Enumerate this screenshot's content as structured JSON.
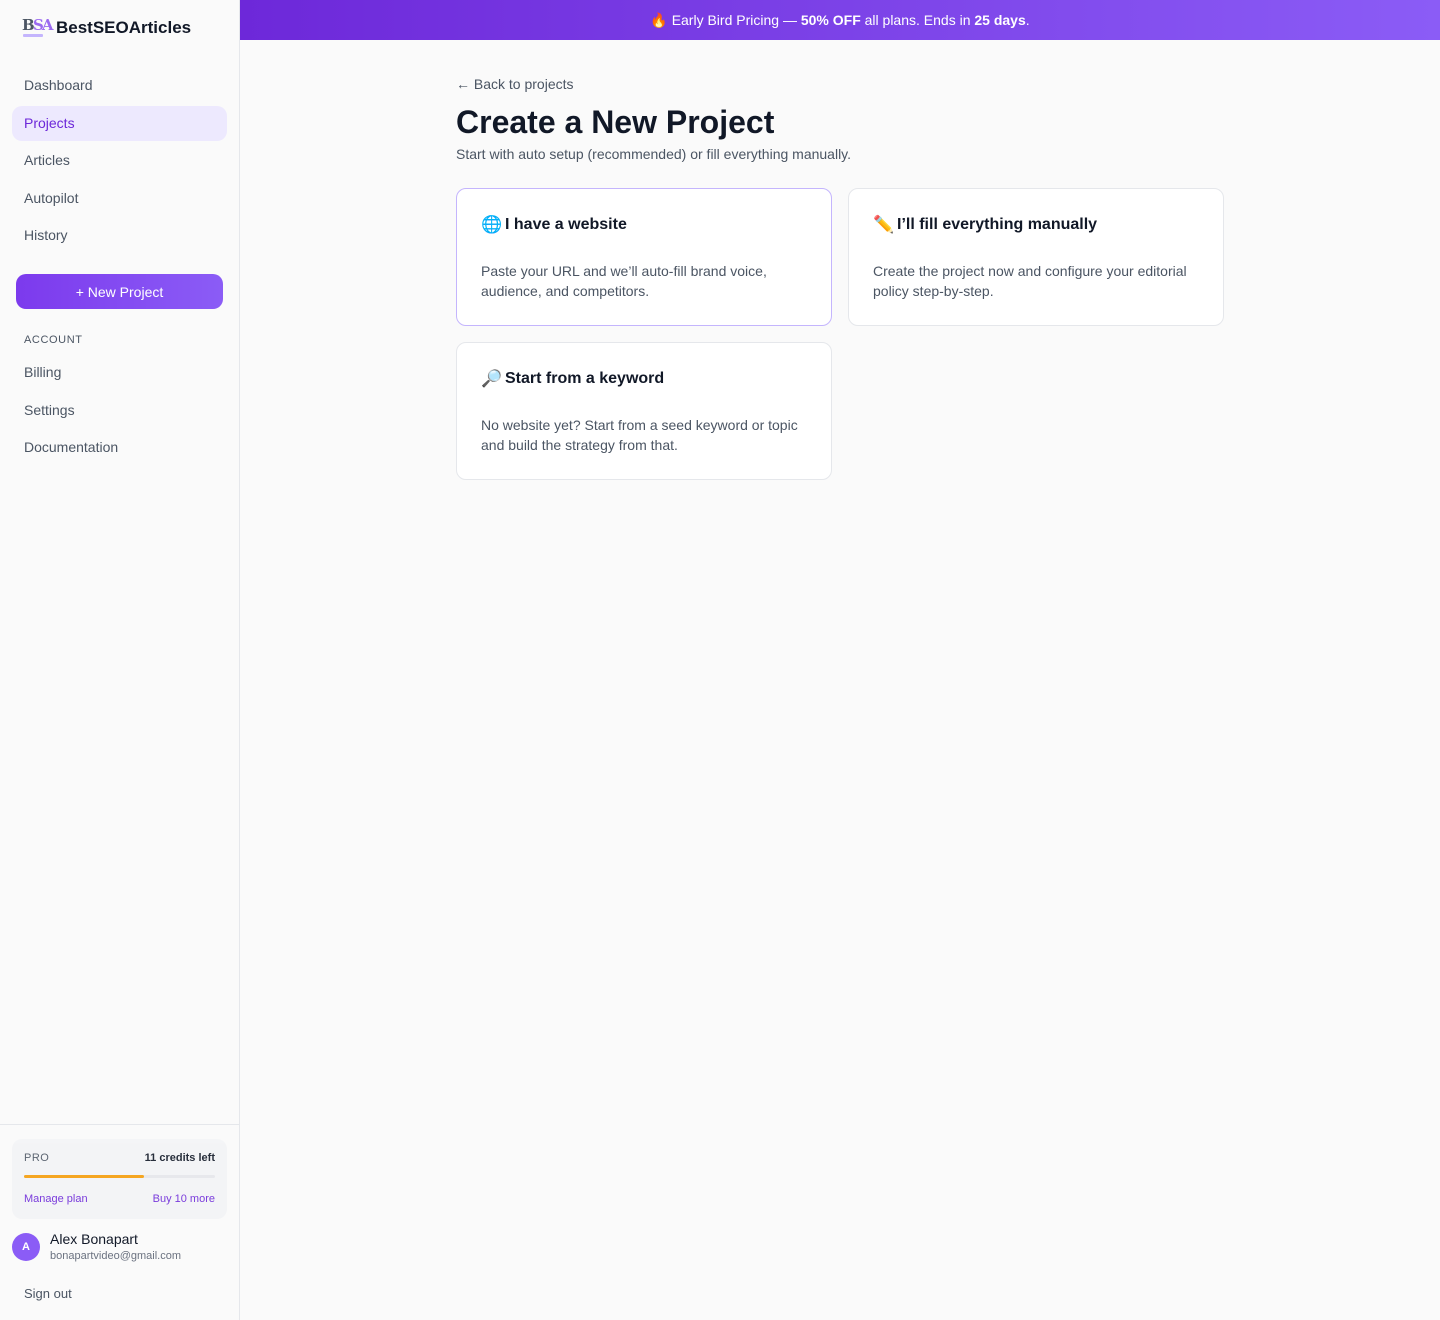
{
  "brand": {
    "logo_letters": "BSA",
    "name": "BestSEOArticles"
  },
  "banner": {
    "emoji": "🔥",
    "lead": "Early Bird Pricing —",
    "discount": "50% OFF",
    "middle": "all plans. Ends in",
    "days": "25 days",
    "end": "."
  },
  "sidebar": {
    "items": [
      {
        "label": "Dashboard"
      },
      {
        "label": "Projects",
        "active": true
      },
      {
        "label": "Articles"
      },
      {
        "label": "Autopilot"
      },
      {
        "label": "History"
      }
    ],
    "new_project_label": "+ New Project",
    "account_label": "ACCOUNT",
    "account_items": [
      {
        "label": "Billing"
      },
      {
        "label": "Settings"
      },
      {
        "label": "Documentation"
      }
    ]
  },
  "plan": {
    "name": "PRO",
    "credits": "11 credits left",
    "progress": 0.63,
    "manage_label": "Manage plan",
    "buy_label": "Buy 10 more"
  },
  "user": {
    "initial": "A",
    "name": "Alex Bonapart",
    "email": "bonapartvideo@gmail.com"
  },
  "signout_label": "Sign out",
  "main": {
    "back_label": "← Back to projects",
    "title": "Create a New Project",
    "subtitle": "Start with auto setup (recommended) or fill everything manually.",
    "options": [
      {
        "icon": "🌐",
        "title": "I have a website",
        "desc": "Paste your URL and we’ll auto-fill brand voice, audience, and competitors."
      },
      {
        "icon": "✏️",
        "title": "I’ll fill everything manually",
        "desc": "Create the project now and configure your editorial policy step-by-step."
      },
      {
        "icon": "🔎",
        "title": "Start from a keyword",
        "desc": "No website yet? Start from a seed keyword or topic and build the strategy from that."
      }
    ]
  },
  "colors": {
    "accent": "#7c3aed",
    "active_bg": "#ede9fe",
    "progress": "#f59e0b"
  }
}
